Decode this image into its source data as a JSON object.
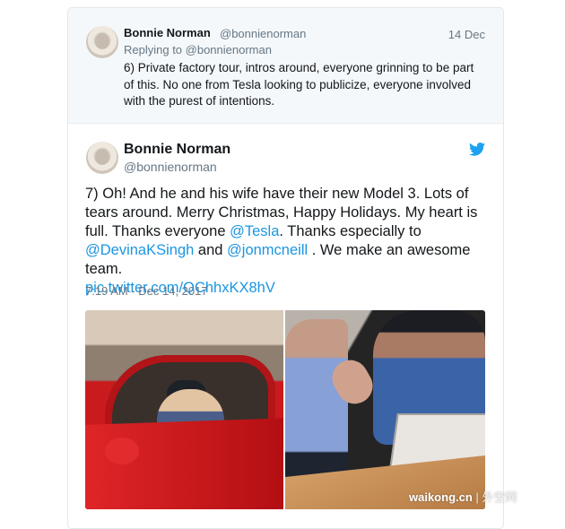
{
  "reply": {
    "name": "Bonnie Norman",
    "handle": "@bonnienorman",
    "date": "14 Dec",
    "replying_to": "Replying to @bonnienorman",
    "text": "6) Private factory tour, intros around, everyone grinning to be part of this. No one from Tesla looking to publicize, everyone involved with the purest of intentions."
  },
  "tweet": {
    "name": "Bonnie Norman",
    "handle": "@bonnienorman",
    "text_parts": [
      "7) Oh! And he and his wife have their new Model 3. Lots of tears around. Merry Christmas, Happy Holidays. My heart is full. Thanks everyone ",
      "@Tesla",
      ". Thanks especially to ",
      "@DevinaKSingh",
      " and ",
      "@jonmcneill",
      " . We make an awesome team.",
      "pic.twitter.com/QChhxKX8hV"
    ],
    "time": "7:19 AM - Dec 14, 2017"
  },
  "watermark": {
    "site": "waikong.cn",
    "separator": "|",
    "name": "外空网"
  },
  "colors": {
    "link": "#1b95e0",
    "twitter_blue": "#1da1f2",
    "muted": "#657786",
    "text": "#14171a"
  },
  "icons": {
    "twitter_logo": "twitter-bird-icon"
  }
}
